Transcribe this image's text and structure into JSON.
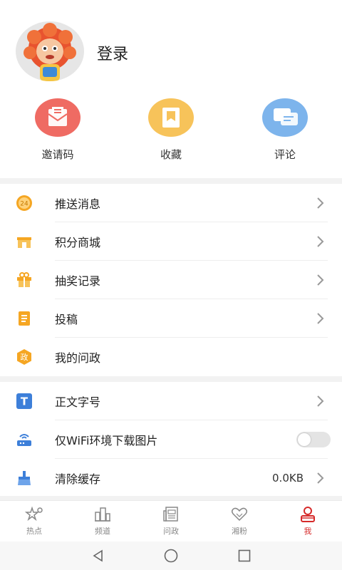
{
  "profile": {
    "login_label": "登录"
  },
  "quick_actions": [
    {
      "label": "邀请码",
      "icon": "envelope-icon",
      "color": "#ef6b63"
    },
    {
      "label": "收藏",
      "icon": "bookmark-icon",
      "color": "#f7c35a"
    },
    {
      "label": "评论",
      "icon": "chat-icon",
      "color": "#7db4ec"
    }
  ],
  "menu_group1": [
    {
      "label": "推送消息",
      "icon": "push-24-icon",
      "chevron": true
    },
    {
      "label": "积分商城",
      "icon": "shop-icon",
      "chevron": true
    },
    {
      "label": "抽奖记录",
      "icon": "gift-icon",
      "chevron": true
    },
    {
      "label": "投稿",
      "icon": "document-icon",
      "chevron": true
    },
    {
      "label": "我的问政",
      "icon": "politics-icon",
      "icon_text": "政",
      "chevron": false
    }
  ],
  "menu_group2": [
    {
      "label": "正文字号",
      "icon": "font-size-icon",
      "icon_text": "T",
      "chevron": true
    },
    {
      "label": "仅WiFi环境下载图片",
      "icon": "wifi-router-icon",
      "toggle_on": false
    },
    {
      "label": "清除缓存",
      "icon": "broom-icon",
      "value": "0.0KB",
      "chevron": true
    }
  ],
  "push_badge_text": "24",
  "tabs": [
    {
      "label": "热点",
      "icon": "stars-icon",
      "active": false
    },
    {
      "label": "频道",
      "icon": "buildings-icon",
      "active": false
    },
    {
      "label": "问政",
      "icon": "newspaper-icon",
      "active": false
    },
    {
      "label": "湘粉",
      "icon": "hearts-icon",
      "active": false
    },
    {
      "label": "我",
      "icon": "user-icon",
      "active": true
    }
  ],
  "colors": {
    "accent": "#d62a2a",
    "orange": "#f5a623"
  }
}
